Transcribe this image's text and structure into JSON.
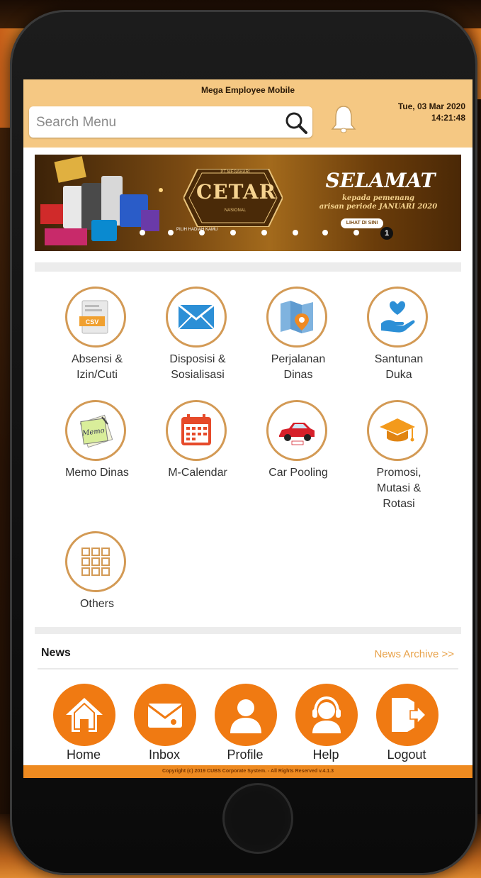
{
  "app": {
    "title": "Mega Employee Mobile",
    "date": "Tue, 03 Mar 2020",
    "time": "14:21:48"
  },
  "search": {
    "placeholder": "Search Menu"
  },
  "banner": {
    "logo_text": "CETAR",
    "logo_small_top": "PT MEGAHARI",
    "logo_small_bottom": "NASIONAL",
    "headline": "SELAMAT",
    "sub1": "kepada pemenang",
    "sub2": "arisan periode JANUARI 2020",
    "cta": "LIHAT DI SINI",
    "strip": "PILIH HADIAH KAMU",
    "page_number": "1"
  },
  "menu": [
    {
      "line1": "Absensi &",
      "line2": "Izin/Cuti",
      "icon": "document-csv-icon"
    },
    {
      "line1": "Disposisi &",
      "line2": "Sosialisasi",
      "icon": "envelope-icon"
    },
    {
      "line1": "Perjalanan",
      "line2": "Dinas",
      "icon": "map-pin-icon"
    },
    {
      "line1": "Santunan",
      "line2": "Duka",
      "icon": "heart-hand-icon"
    },
    {
      "line1": "Memo Dinas",
      "line2": "",
      "icon": "memo-icon"
    },
    {
      "line1": "M-Calendar",
      "line2": "",
      "icon": "calendar-icon"
    },
    {
      "line1": "Car Pooling",
      "line2": "",
      "icon": "car-icon"
    },
    {
      "line1": "Promosi,",
      "line2": "Mutasi &",
      "line3": "Rotasi",
      "icon": "graduation-cap-icon"
    },
    {
      "line1": "Others",
      "line2": "",
      "icon": "grid-icon"
    }
  ],
  "news": {
    "title": "News",
    "archive": "News Archive  >>"
  },
  "nav": [
    {
      "label": "Home",
      "icon": "home-icon"
    },
    {
      "label": "Inbox",
      "icon": "mail-icon"
    },
    {
      "label": "Profile",
      "icon": "user-icon"
    },
    {
      "label": "Help",
      "icon": "headset-icon"
    },
    {
      "label": "Logout",
      "icon": "logout-icon"
    }
  ],
  "footer": {
    "text": "Copyright (c) 2019 CUBS Corporate System. - All Rights Reserved v.4.1.3"
  },
  "colors": {
    "header": "#f5c883",
    "accent": "#f07a12",
    "ring": "#d39a55",
    "footer": "#ee8a20"
  }
}
